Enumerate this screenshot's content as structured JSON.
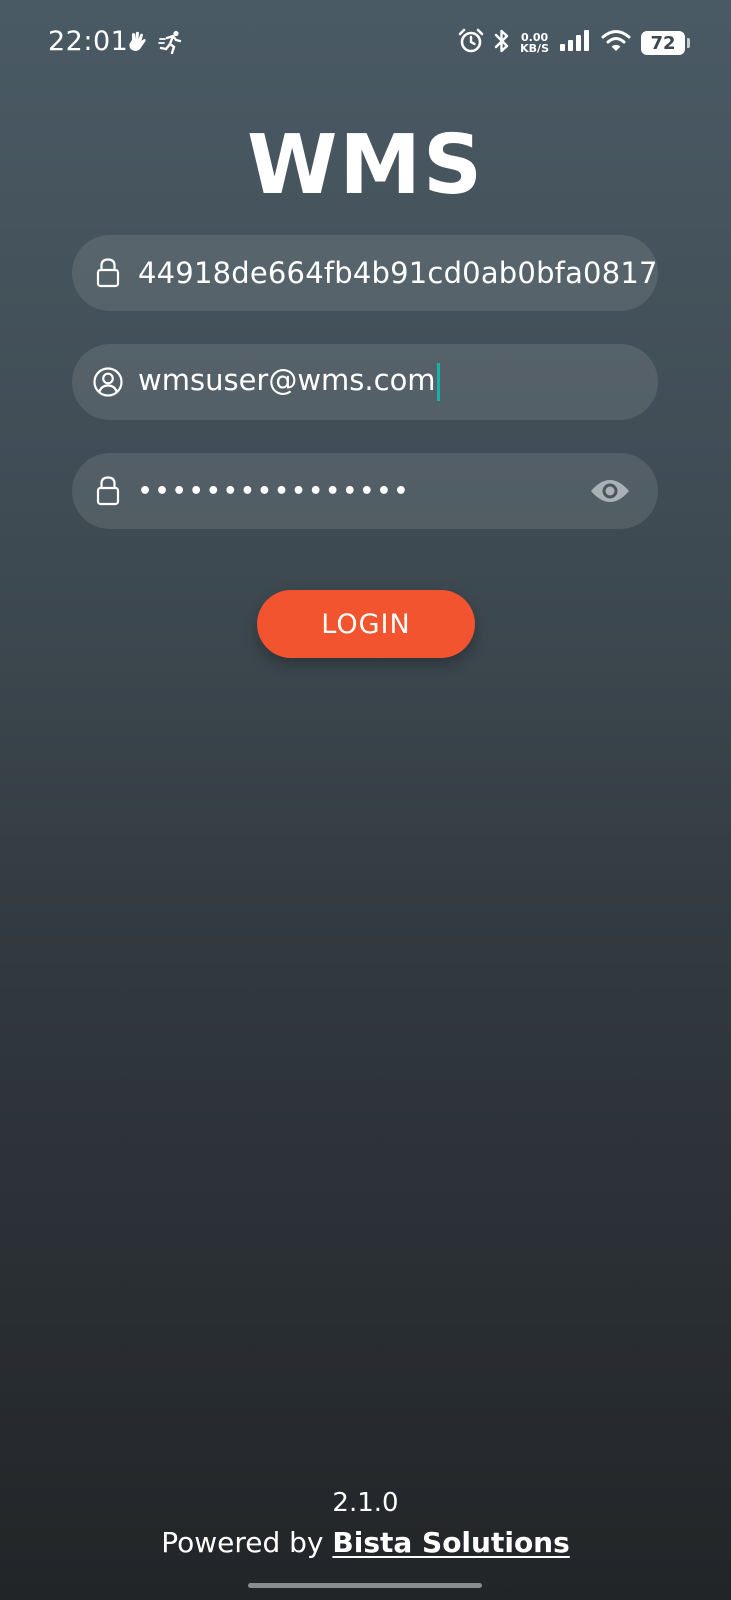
{
  "status_bar": {
    "time": "22:01",
    "net_speed_value": "0.00",
    "net_speed_unit": "KB/S",
    "battery_level": "72",
    "icons": [
      "hand-icon",
      "running-icon",
      "alarm-icon",
      "bluetooth-icon",
      "signal-icon",
      "wifi-icon",
      "battery-icon"
    ]
  },
  "app": {
    "title": "WMS"
  },
  "form": {
    "license_value": "44918de664fb4b91cd0ab0bfa0817",
    "email_value": "wmsuser@wms.com",
    "password_mask": "••••••••••••••••",
    "login_label": "LOGIN"
  },
  "footer": {
    "version": "2.1.0",
    "powered_prefix": "Powered by ",
    "company": "Bista Solutions"
  },
  "colors": {
    "accent": "#f1542f",
    "caret": "#19b0a8"
  }
}
